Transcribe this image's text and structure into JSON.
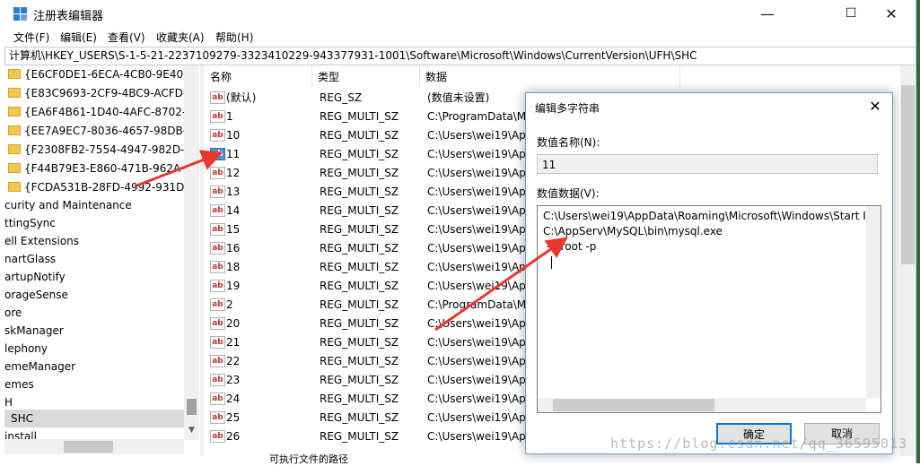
{
  "window": {
    "title": "注册表编辑器",
    "controls": {
      "minimize": "—",
      "maximize": "☐",
      "close": "✕"
    }
  },
  "menu": [
    "文件(F)",
    "编辑(E)",
    "查看(V)",
    "收藏夹(A)",
    "帮助(H)"
  ],
  "address": "计算机\\HKEY_USERS\\S-1-5-21-2237109279-3323410229-943377931-1001\\Software\\Microsoft\\Windows\\CurrentVersion\\UFH\\SHC",
  "tree": {
    "items": [
      {
        "label": "{E6CF0DE1-6ECA-4CB0-9E40-B",
        "folder": true
      },
      {
        "label": "{E83C9693-2CF9-4BC9-ACFD-0",
        "folder": true
      },
      {
        "label": "{EA6F4B61-1D40-4AFC-8702-C",
        "folder": true
      },
      {
        "label": "{EE7A9EC7-8036-4657-98DB-E",
        "folder": true
      },
      {
        "label": "{F2308FB2-7554-4947-982D-43",
        "folder": true
      },
      {
        "label": "{F44B79E3-E860-471B-962A-9",
        "folder": true
      },
      {
        "label": "{FCDA531B-28FD-4992-931D-E",
        "folder": true
      },
      {
        "label": "curity and Maintenance",
        "folder": false
      },
      {
        "label": "ttingSync",
        "folder": false
      },
      {
        "label": "ell Extensions",
        "folder": false
      },
      {
        "label": "nartGlass",
        "folder": false
      },
      {
        "label": "artupNotify",
        "folder": false
      },
      {
        "label": "orageSense",
        "folder": false
      },
      {
        "label": "ore",
        "folder": false
      },
      {
        "label": "skManager",
        "folder": false
      },
      {
        "label": "lephony",
        "folder": false
      },
      {
        "label": "emeManager",
        "folder": false
      },
      {
        "label": "emes",
        "folder": false
      },
      {
        "label": "H",
        "folder": false
      },
      {
        "label": "SHC",
        "folder": true,
        "selected": true
      },
      {
        "label": "install",
        "folder": false
      }
    ]
  },
  "list": {
    "headers": {
      "name": "名称",
      "type": "类型",
      "data": "数据"
    },
    "rows": [
      {
        "name": "(默认)",
        "type": "REG_SZ",
        "data": "(数值未设置)"
      },
      {
        "name": "1",
        "type": "REG_MULTI_SZ",
        "data": "C:\\ProgramData\\M"
      },
      {
        "name": "10",
        "type": "REG_MULTI_SZ",
        "data": "C:\\Users\\wei19\\Ap"
      },
      {
        "name": "11",
        "type": "REG_MULTI_SZ",
        "data": "C:\\Users\\wei19\\Ap",
        "selected": true
      },
      {
        "name": "12",
        "type": "REG_MULTI_SZ",
        "data": "C:\\Users\\wei19\\Ap"
      },
      {
        "name": "13",
        "type": "REG_MULTI_SZ",
        "data": "C:\\Users\\wei19\\Ap"
      },
      {
        "name": "14",
        "type": "REG_MULTI_SZ",
        "data": "C:\\Users\\wei19\\Ap"
      },
      {
        "name": "15",
        "type": "REG_MULTI_SZ",
        "data": "C:\\Users\\wei19\\Ap"
      },
      {
        "name": "16",
        "type": "REG_MULTI_SZ",
        "data": "C:\\Users\\wei19\\Ap"
      },
      {
        "name": "18",
        "type": "REG_MULTI_SZ",
        "data": "C:\\Users\\wei19\\Ap"
      },
      {
        "name": "19",
        "type": "REG_MULTI_SZ",
        "data": "C:\\Users\\wei19\\Ap"
      },
      {
        "name": "2",
        "type": "REG_MULTI_SZ",
        "data": "C:\\ProgramData\\M"
      },
      {
        "name": "20",
        "type": "REG_MULTI_SZ",
        "data": "C:\\Users\\wei19\\Ap"
      },
      {
        "name": "21",
        "type": "REG_MULTI_SZ",
        "data": "C:\\Users\\wei19\\Ap"
      },
      {
        "name": "22",
        "type": "REG_MULTI_SZ",
        "data": "C:\\Users\\wei19\\Ap"
      },
      {
        "name": "23",
        "type": "REG_MULTI_SZ",
        "data": "C:\\Users\\wei19\\Ap"
      },
      {
        "name": "24",
        "type": "REG_MULTI_SZ",
        "data": "C:\\Users\\wei19\\Ap"
      },
      {
        "name": "25",
        "type": "REG_MULTI_SZ",
        "data": "C:\\Users\\wei19\\Ap"
      },
      {
        "name": "26",
        "type": "REG_MULTI_SZ",
        "data": "C:\\Users\\wei19\\Ap"
      }
    ]
  },
  "status": "可执行文件的路径",
  "dialog": {
    "title": "编辑多字符串",
    "name_label": "数值名称(N):",
    "name_value": "11",
    "data_label": "数值数据(V):",
    "data_lines": [
      "C:\\Users\\wei19\\AppData\\Roaming\\Microsoft\\Windows\\Start I",
      "C:\\AppServ\\MySQL\\bin\\mysql.exe",
      " -u root -p"
    ],
    "ok": "确定",
    "cancel": "取消"
  },
  "watermark": "https://blog.csdn.net/qq_36595013",
  "colors": {
    "accent": "#0078d7",
    "arrow": "#e8372c",
    "selection": "#cce8ff"
  }
}
